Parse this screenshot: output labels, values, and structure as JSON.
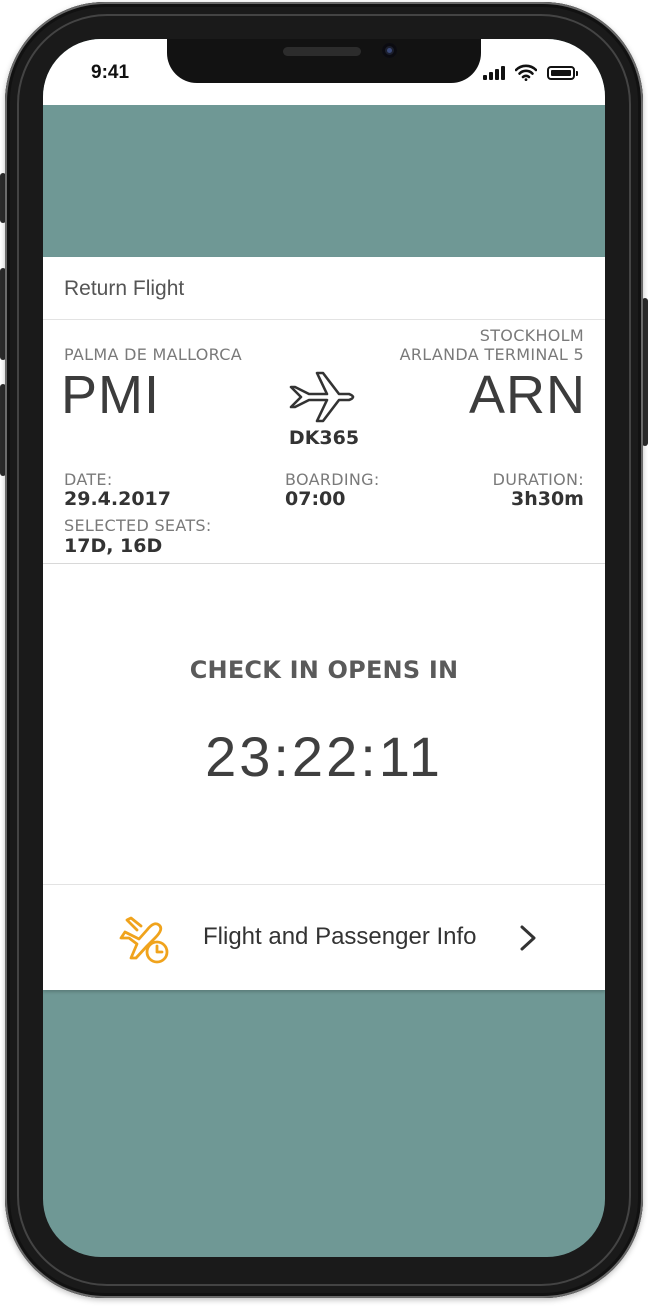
{
  "status_bar": {
    "time": "9:41"
  },
  "card": {
    "title": "Return Flight",
    "origin": {
      "city": "PALMA DE MALLORCA",
      "code": "PMI"
    },
    "destination": {
      "city_line1": "STOCKHOLM",
      "city_line2": "ARLANDA TERMINAL 5",
      "code": "ARN"
    },
    "flight_number": "DK365",
    "date": {
      "label": "DATE:",
      "value": "29.4.2017"
    },
    "boarding": {
      "label": "BOARDING:",
      "value": "07:00"
    },
    "duration": {
      "label": "DURATION:",
      "value": "3h30m"
    },
    "seats": {
      "label": "SELECTED SEATS:",
      "value": "17D, 16D"
    }
  },
  "checkin": {
    "label": "CHECK IN OPENS IN",
    "countdown": "23:22:11"
  },
  "info_row": {
    "label": "Flight and Passenger Info"
  },
  "colors": {
    "background_teal": "#6f9895",
    "accent_orange": "#f0a31c",
    "text_dark": "#333333",
    "text_muted": "#7a7a7a"
  },
  "icons": {
    "route": "airplane-icon",
    "info": "airplane-clock-icon",
    "chevron": "chevron-right-icon",
    "signal": "cellular-signal-icon",
    "wifi": "wifi-icon",
    "battery": "battery-icon"
  }
}
